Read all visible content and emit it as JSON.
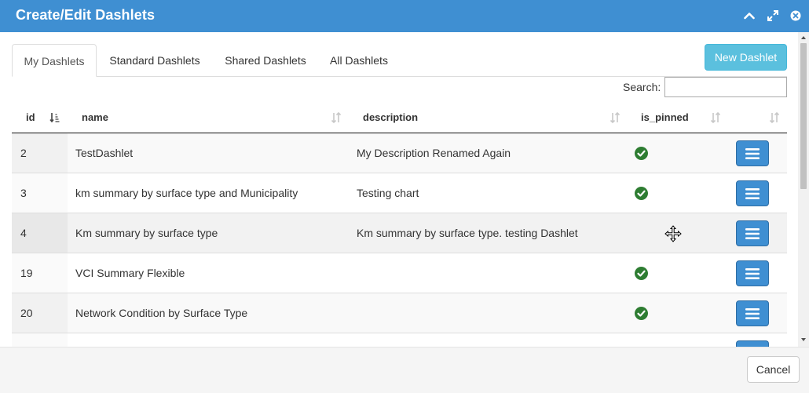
{
  "dialog": {
    "title": "Create/Edit Dashlets"
  },
  "tabs": [
    {
      "label": "My Dashlets",
      "active": true
    },
    {
      "label": "Standard Dashlets",
      "active": false
    },
    {
      "label": "Shared Dashlets",
      "active": false
    },
    {
      "label": "All Dashlets",
      "active": false
    }
  ],
  "toolbar": {
    "new_label": "New Dashlet"
  },
  "search": {
    "label": "Search:",
    "value": ""
  },
  "table": {
    "columns": [
      "id",
      "name",
      "description",
      "is_pinned"
    ],
    "rows": [
      {
        "id": "2",
        "name": "TestDashlet",
        "description": "My Description Renamed Again",
        "pinned": true
      },
      {
        "id": "3",
        "name": "km summary by surface type and Municipality",
        "description": "Testing chart",
        "pinned": true
      },
      {
        "id": "4",
        "name": "Km summary by surface type",
        "description": "Km summary by surface type. testing Dashlet",
        "pinned": false
      },
      {
        "id": "19",
        "name": "VCI Summary Flexible",
        "description": "",
        "pinned": true
      },
      {
        "id": "20",
        "name": "Network Condition by Surface Type",
        "description": "",
        "pinned": true
      }
    ]
  },
  "footer": {
    "cancel_label": "Cancel"
  },
  "colors": {
    "header": "#3f8fd2",
    "new_button": "#5bc0de",
    "pin_check": "#2e7d32",
    "menu_button": "#3f8fd2"
  },
  "icons": [
    "chevron-up-icon",
    "expand-icon",
    "close-icon",
    "sort-icon",
    "check-circle-icon",
    "hamburger-icon",
    "move-cursor-icon"
  ]
}
